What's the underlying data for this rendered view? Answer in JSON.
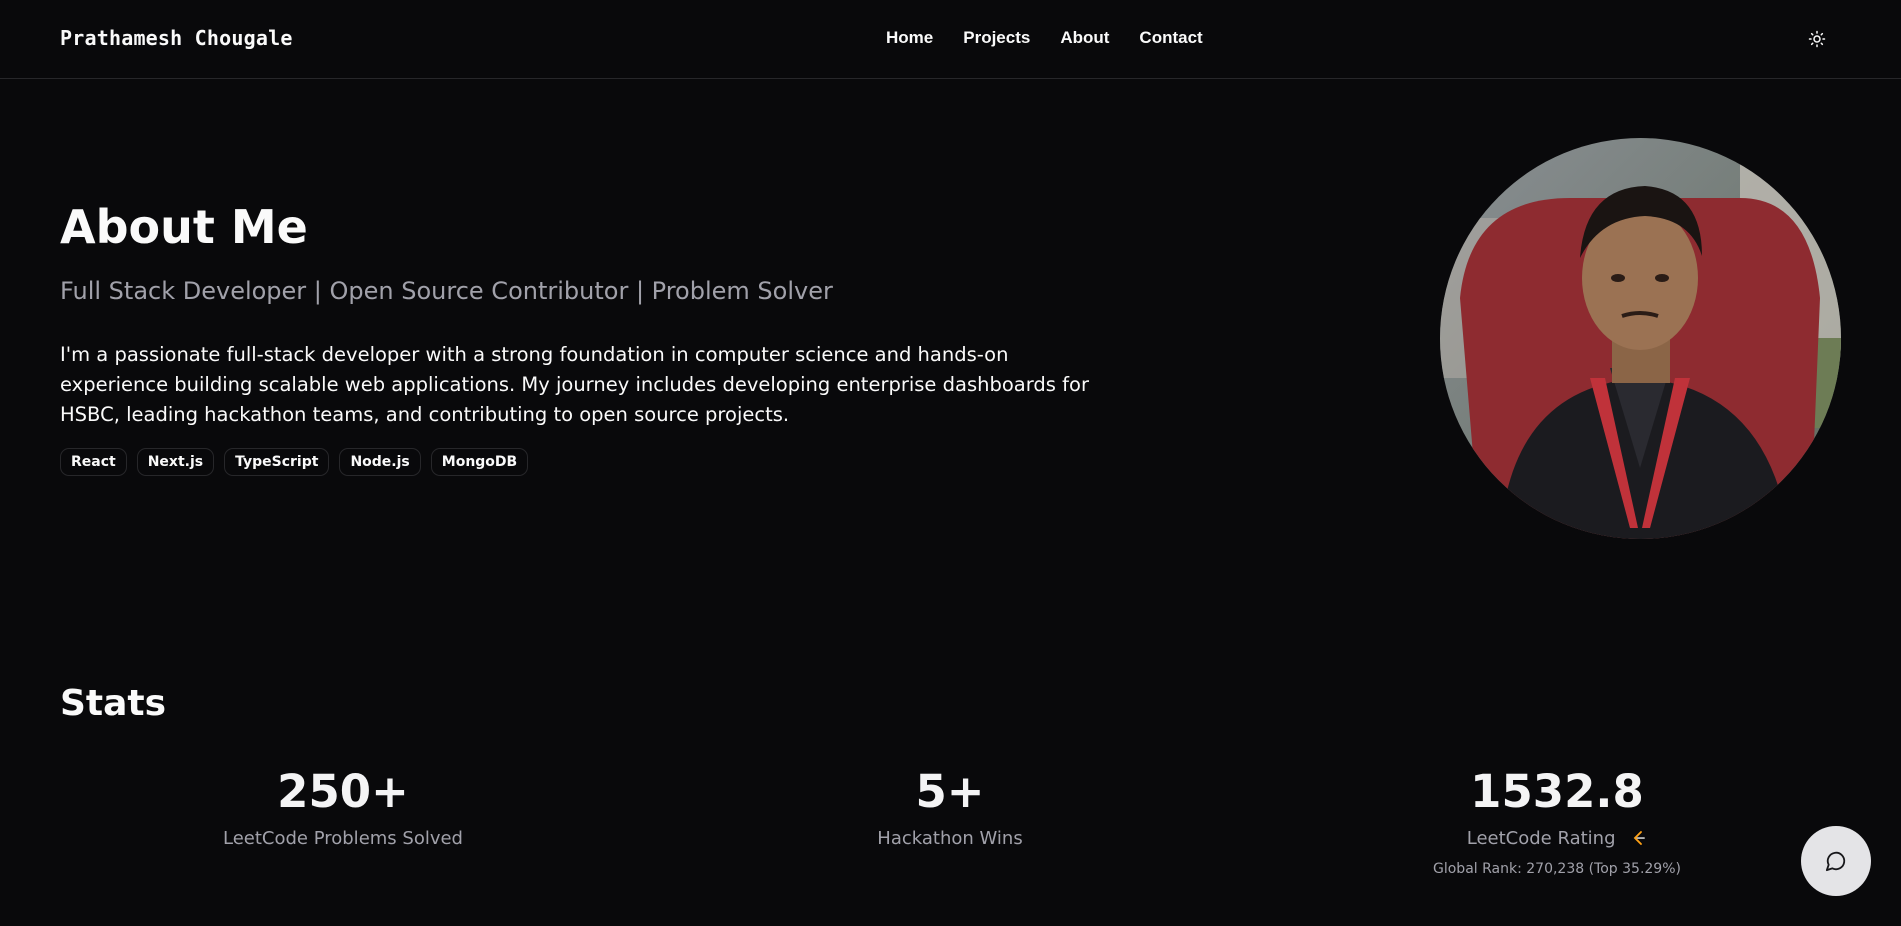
{
  "header": {
    "brand": "Prathamesh Chougale",
    "nav": [
      "Home",
      "Projects",
      "About",
      "Contact"
    ],
    "theme_icon": "sun-icon"
  },
  "about": {
    "title": "About Me",
    "subtitle": "Full Stack Developer | Open Source Contributor | Problem Solver",
    "bio": "I'm a passionate full-stack developer with a strong foundation in computer science and hands-on experience building scalable web applications. My journey includes developing enterprise dashboards for HSBC, leading hackathon teams, and contributing to open source projects.",
    "tags": [
      "React",
      "Next.js",
      "TypeScript",
      "Node.js",
      "MongoDB"
    ]
  },
  "stats": {
    "title": "Stats",
    "items": [
      {
        "value": "250+",
        "label": "LeetCode Problems Solved"
      },
      {
        "value": "5+",
        "label": "Hackathon Wins"
      },
      {
        "value": "1532.8",
        "label": "LeetCode Rating",
        "extra": "Global Rank: 270,238 (Top 35.29%)",
        "icon": "leetcode-icon"
      }
    ]
  },
  "chat": {
    "icon": "chat-bubble-icon"
  },
  "colors": {
    "background": "#09090b",
    "text": "#fafafa",
    "muted": "#a1a1aa",
    "border": "#27272a",
    "leetcode_orange": "#ffa116"
  }
}
